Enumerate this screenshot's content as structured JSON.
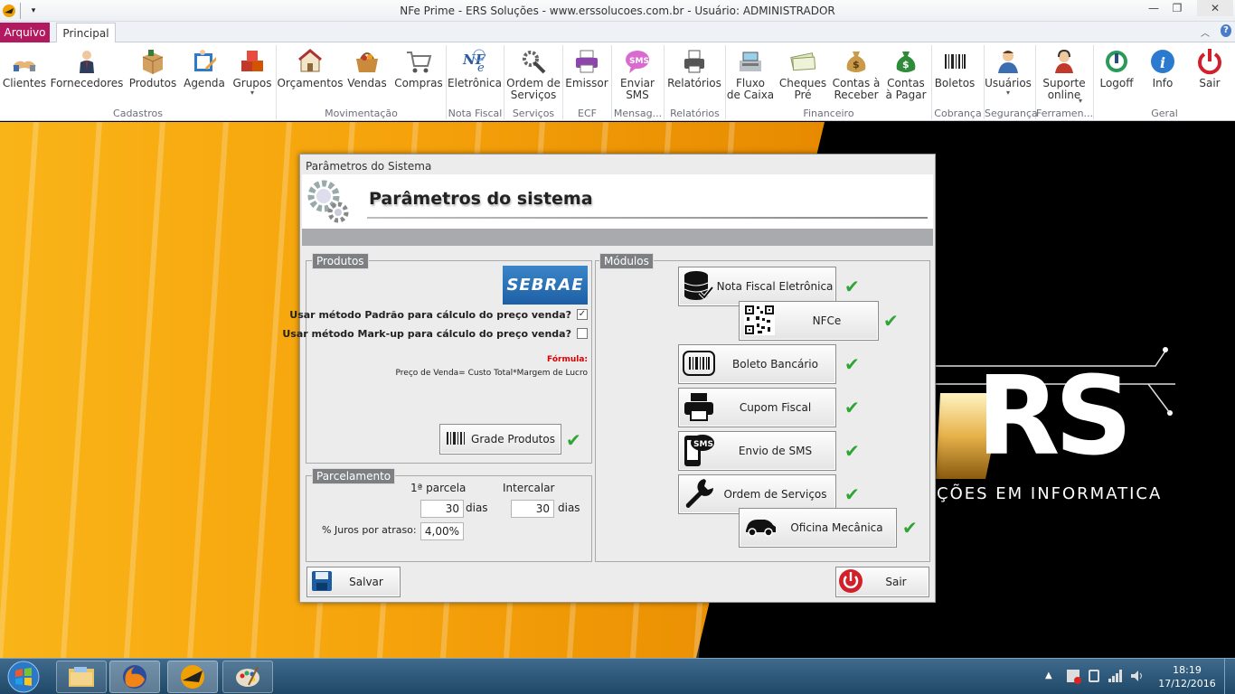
{
  "window": {
    "title": "NFe Prime - ERS Soluções - www.erssolucoes.com.br - Usuário: ADMINISTRADOR",
    "controls": {
      "minimize": "—",
      "maximize": "❐",
      "close": "✕"
    }
  },
  "tabs": {
    "file": "Arquivo",
    "main": "Principal"
  },
  "ribbon": {
    "buttons": [
      {
        "label": "Clientes",
        "icon": "clients-icon"
      },
      {
        "label": "Fornecedores",
        "icon": "supplier-icon"
      },
      {
        "label": "Produtos",
        "icon": "products-box-icon"
      },
      {
        "label": "Agenda",
        "icon": "agenda-icon"
      },
      {
        "label": "Grupos",
        "icon": "groups-icon"
      },
      {
        "label": "Orçamentos",
        "icon": "budget-icon"
      },
      {
        "label": "Vendas",
        "icon": "sales-basket-icon"
      },
      {
        "label": "Compras",
        "icon": "shopping-cart-icon"
      },
      {
        "label": "Eletrônica",
        "icon": "nfe-icon"
      },
      {
        "label": "Ordem de\nServiços",
        "icon": "service-tools-icon"
      },
      {
        "label": "Emissor",
        "icon": "printer-icon"
      },
      {
        "label": "Enviar\nSMS",
        "icon": "sms-icon"
      },
      {
        "label": "Relatórios",
        "icon": "reports-printer-icon"
      },
      {
        "label": "Fluxo\nde Caixa",
        "icon": "cash-flow-icon"
      },
      {
        "label": "Cheques\nPré",
        "icon": "checks-icon"
      },
      {
        "label": "Contas à\nReceber",
        "icon": "money-bag-icon"
      },
      {
        "label": "Contas\nà Pagar",
        "icon": "money-bag-pay-icon"
      },
      {
        "label": "Boletos",
        "icon": "barcode-icon"
      },
      {
        "label": "Usuários",
        "icon": "users-icon"
      },
      {
        "label": "Suporte\nonline",
        "icon": "support-icon"
      },
      {
        "label": "Logoff",
        "icon": "logoff-icon"
      },
      {
        "label": "Info",
        "icon": "info-icon"
      },
      {
        "label": "Sair",
        "icon": "power-icon"
      }
    ],
    "groups": [
      "Cadastros",
      "Movimentação",
      "Nota Fiscal",
      "Serviços",
      "ECF",
      "Mensag...",
      "Relatórios",
      "Financeiro",
      "Cobrança",
      "Segurança",
      "Ferramen...",
      "Geral"
    ]
  },
  "background": {
    "tagline": "ÇÕES EM INFORMATICA",
    "logo_text": "RS"
  },
  "dialog": {
    "window_title": "Parâmetros do Sistema",
    "header_title": "Parâmetros do sistema",
    "produtos": {
      "legend": "Produtos",
      "sebrae": "SEBRAE",
      "opt_padrao": "Usar método Padrão para cálculo do preço venda?",
      "opt_padrao_checked": true,
      "opt_markup": "Usar método Mark-up para cálculo do preço venda?",
      "opt_markup_checked": false,
      "formula_label": "Fórmula:",
      "formula": "Preço de Venda= Custo Total*Margem de Lucro",
      "grade_button": "Grade Produtos"
    },
    "parcelamento": {
      "legend": "Parcelamento",
      "first_label": "1ª parcela",
      "interval_label": "Intercalar",
      "first_value": "30",
      "interval_value": "30",
      "days": "dias",
      "interest_label": "% Juros por atraso:",
      "interest_value": "4,00%"
    },
    "modulos": {
      "legend": "Módulos",
      "items": [
        {
          "label": "Nota Fiscal Eletrônica",
          "icon": "database-check-icon"
        },
        {
          "label": "NFCe",
          "icon": "qr-code-icon"
        },
        {
          "label": "Boleto Bancário",
          "icon": "barcode-icon"
        },
        {
          "label": "Cupom Fiscal",
          "icon": "printer-icon"
        },
        {
          "label": "Envio de SMS",
          "icon": "sms-phone-icon"
        },
        {
          "label": "Ordem de Serviços",
          "icon": "wrench-icon"
        },
        {
          "label": "Oficina Mecânica",
          "icon": "car-icon"
        }
      ]
    },
    "save_button": "Salvar",
    "exit_button": "Sair"
  },
  "taskbar": {
    "time": "18:19",
    "date": "17/12/2016"
  },
  "colors": {
    "accent": "#b3195f",
    "check": "#2fa536",
    "orange": "#f4a000"
  }
}
